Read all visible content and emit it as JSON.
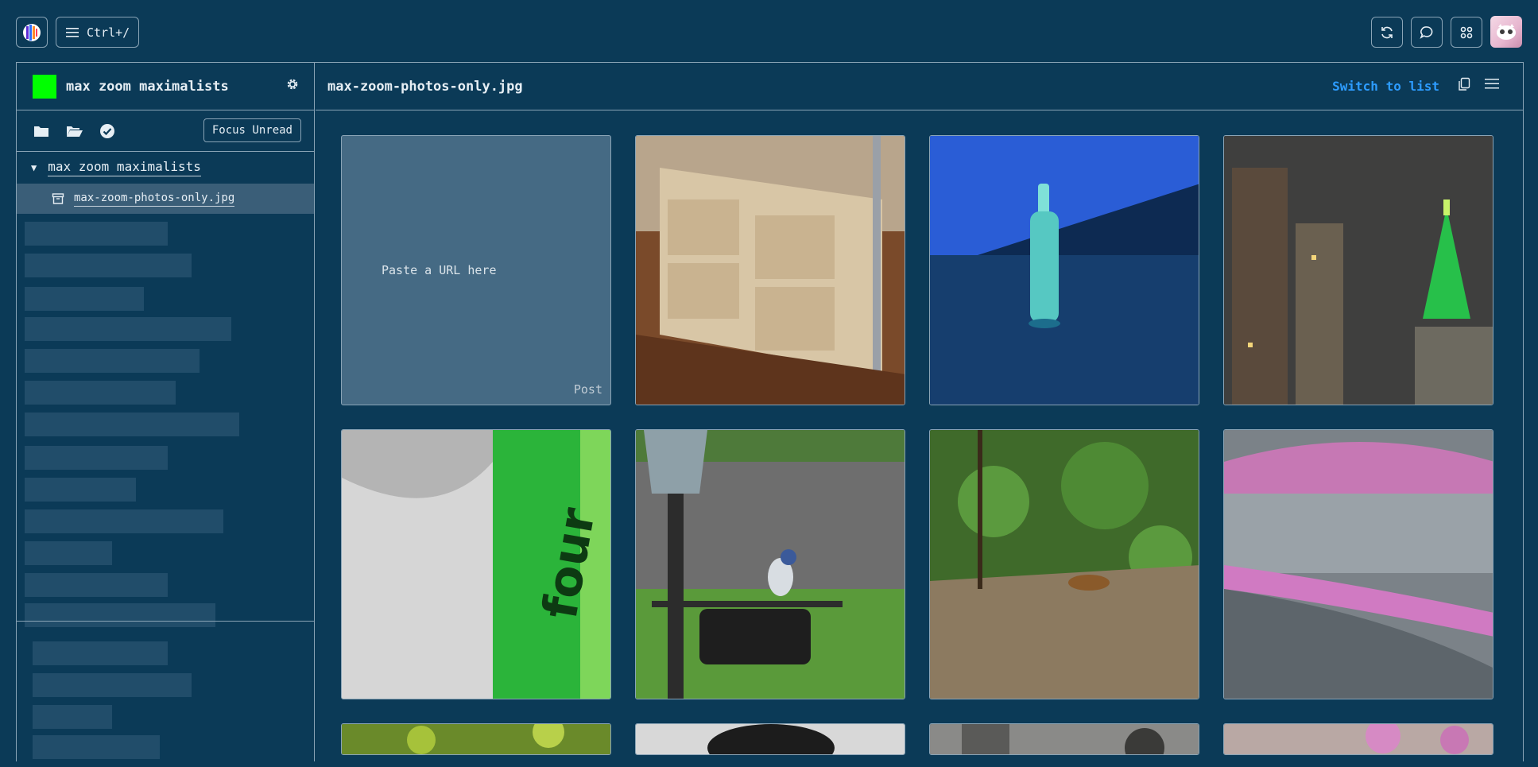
{
  "topbar": {
    "menu_shortcut": "Ctrl+/",
    "icons": [
      "refresh-icon",
      "chat-icon",
      "puzzle-icon"
    ]
  },
  "sidebar": {
    "workspace_name": "max zoom maximalists",
    "workspace_color": "#00ff00",
    "focus_button": "Focus Unread",
    "tree": {
      "root_label": "max zoom maximalists",
      "file_label": "max-zoom-photos-only.jpg"
    }
  },
  "main": {
    "title": "max-zoom-photos-only.jpg",
    "switch_link": "Switch to list",
    "paste_placeholder": "Paste a URL here",
    "post_label": "Post"
  },
  "colors": {
    "background": "#0b3a57",
    "accent_link": "#2d9cff",
    "selected_row": "#3a5e78"
  }
}
